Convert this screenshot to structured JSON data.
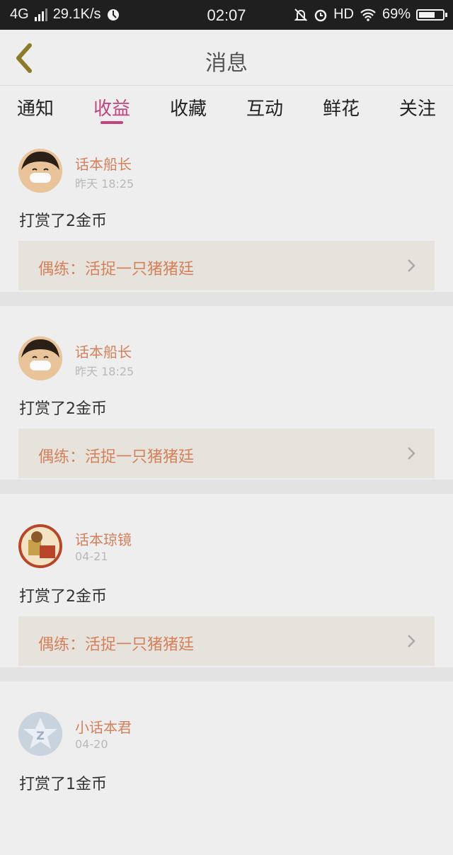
{
  "status_bar": {
    "network": "4G",
    "speed": "29.1K/s",
    "time": "02:07",
    "hd": "HD",
    "battery": "69%",
    "battery_level": 0.69
  },
  "header": {
    "title": "消息"
  },
  "tabs": [
    {
      "label": "通知",
      "active": false
    },
    {
      "label": "收益",
      "active": true
    },
    {
      "label": "收藏",
      "active": false
    },
    {
      "label": "互动",
      "active": false
    },
    {
      "label": "鲜花",
      "active": false
    },
    {
      "label": "关注",
      "active": false
    }
  ],
  "messages": [
    {
      "user": "话本船长",
      "time": "昨天 18:25",
      "text": "打赏了2金币",
      "link": "偶练：活捉一只猪猪廷"
    },
    {
      "user": "话本船长",
      "time": "昨天 18:25",
      "text": "打赏了2金币",
      "link": "偶练：活捉一只猪猪廷"
    },
    {
      "user": "话本琼镜",
      "time": "04-21",
      "text": "打赏了2金币",
      "link": "偶练：活捉一只猪猪廷"
    },
    {
      "user": "小话本君",
      "time": "04-20",
      "text": "打赏了1金币",
      "link": ""
    }
  ],
  "colors": {
    "accent": "#c2447f",
    "username": "#d5805a",
    "background": "#eeeeee"
  }
}
